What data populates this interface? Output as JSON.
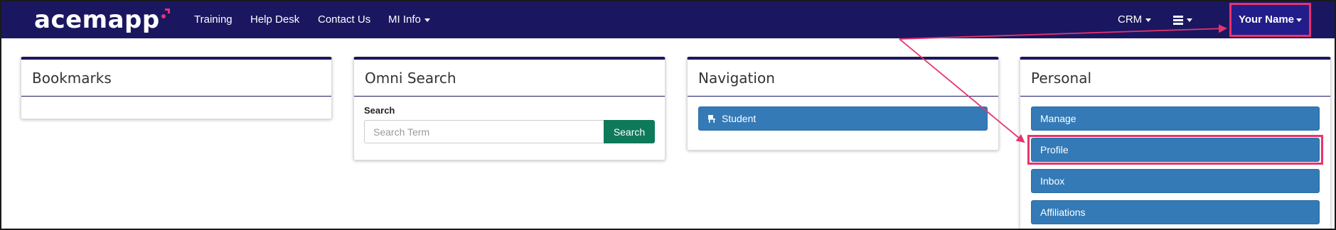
{
  "brand": {
    "logo_text": "acemapp"
  },
  "nav": {
    "training": "Training",
    "help_desk": "Help Desk",
    "contact_us": "Contact Us",
    "mi_info": "MI Info",
    "crm": "CRM",
    "user_name": "Your Name"
  },
  "panels": {
    "bookmarks": {
      "title": "Bookmarks"
    },
    "omni_search": {
      "title": "Omni Search",
      "label": "Search",
      "placeholder": "Search Term",
      "button": "Search"
    },
    "navigation": {
      "title": "Navigation",
      "student": "Student"
    },
    "personal": {
      "title": "Personal",
      "manage": "Manage",
      "profile": "Profile",
      "inbox": "Inbox",
      "affiliations": "Affiliations"
    }
  },
  "colors": {
    "navbar": "#1a1760",
    "highlight": "#e8336d",
    "button_blue": "#337ab7",
    "search_green": "#0e7a5a"
  },
  "icons": {
    "student": "student-desk-icon",
    "menu": "hamburger-icon"
  }
}
